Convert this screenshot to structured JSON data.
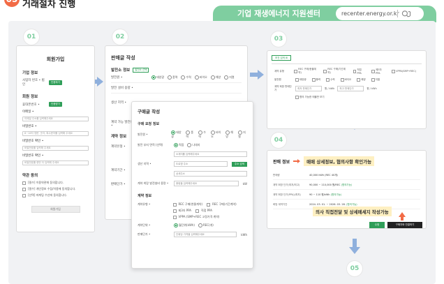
{
  "header": {
    "step_number": "05",
    "title": "거래절차 진행",
    "center_name": "기업 재생에너지 지원센터",
    "url": "recenter.energy.or.kr"
  },
  "steps": [
    "01",
    "02",
    "03",
    "04",
    "05"
  ],
  "card1": {
    "heading": "회원가입",
    "company_section": "기업 정보",
    "company_rows": [
      {
        "label": "사업자 번호 • 법인",
        "button": "인증하기"
      }
    ],
    "member_section": "회원 정보",
    "member_rows": [
      {
        "label": "휴대폰번호 •",
        "button": "인증받기"
      },
      {
        "label": "이메일 •",
        "value": "이메일 주소를 입력해주세요"
      },
      {
        "label": "비밀번호 •",
        "value": "8~16자 영문, 숫자, 특수문자를 입력해 주세요"
      },
      {
        "label": "비밀번호 확인 •",
        "value": "비밀번호를 입력해 주세요"
      },
      {
        "label": "비밀번호 확인 •",
        "value": "비밀번호를 한번 더 입력해 주세요"
      }
    ],
    "terms_section": "약관 동의",
    "terms": [
      "[필수] 이용약관에 동의합니다.",
      "[필수] 개인정보 수집/이용에 동의합니다.",
      "[선택] 마케팅 수신에 동의합니다."
    ],
    "submit": "회원가입"
  },
  "card2": {
    "heading": "판매글 작성",
    "section": "발전소 정보",
    "tag": "발전소 선택",
    "rows": [
      {
        "label": "발전원 •",
        "options": [
          "태양광",
          "풍력",
          "수력",
          "바이오",
          "해양",
          "지열"
        ]
      },
      {
        "label": "발전 설비 용량 •",
        "value": ""
      },
      {
        "label": "생산 지역 •",
        "value": ""
      },
      {
        "label": "계약 가능 발전량 •",
        "value": ""
      }
    ],
    "contract_section": "계약 정보",
    "contract_rows": [
      {
        "label": "계약유형 •"
      },
      {
        "label": "계약기간 •"
      },
      {
        "label": "판매단가 •"
      }
    ]
  },
  "card2b": {
    "heading": "구매글 작성",
    "section": "구매 요청 정보",
    "rows": [
      {
        "label": "발전원 •",
        "options": [
          "태양광",
          "풍력",
          "수력",
          "바이오",
          "해양",
          "지열"
        ]
      },
      {
        "label": "발전 부지 면적 (선택)",
        "options": [
          "직접",
          "시/도/구",
          "나대지"
        ],
        "value": "소재지를 입력해주세요"
      },
      {
        "label": "생산 지역 •",
        "value": "도로명 주소",
        "button": "주소 검색",
        "value2": "상세주소"
      },
      {
        "label": "계약 희망 발전설비 용량 •",
        "value": "용량을 입력해주세요",
        "unit": "kW"
      }
    ],
    "contract_section": "계약 정보",
    "contract_types": [
      "REC 구매(현물계약)",
      "REC 구매(기간계약)",
      "제3자 PPA",
      "직접 PPA",
      "VPPA (SMP+REC 고정가격 계약)"
    ],
    "contract_rows": [
      {
        "label": "계약유형 •"
      },
      {
        "label": "계약단위 •",
        "options": [
          "월단위(kWh)",
          "REC(개)"
        ]
      },
      {
        "label": "판매단가 •",
        "value": "단위당 가격을 입력해주세요",
        "unit": "kWh"
      }
    ]
  },
  "card3": {
    "tab": "조건 검색 ⊞",
    "rows": [
      {
        "label": "계약 유형",
        "options": [
          "REC 구매(현물계약)",
          "REC 구매(기간계약)",
          "직접 PPA",
          "제3자 PPA",
          "VPPA(SMP+REC)"
        ]
      },
      {
        "label": "발전원",
        "options": [
          "태양광",
          "풍력",
          "수력",
          "바이오",
          "해양",
          "지열"
        ]
      },
      {
        "label": "계약 희망 판매단가",
        "min": "최저 판매단가",
        "max": "최고 판매단가",
        "unit": "원 / kWh"
      },
      {
        "label": "",
        "options": [
          "협의 가능한 매물만 보기"
        ]
      }
    ]
  },
  "card4": {
    "title": "판매 정보",
    "highlight": "매매 상세정보, 협의사항 확인가능",
    "rows": [
      {
        "label": "판매량",
        "value": "40,000 kWh (REC 40개)"
      },
      {
        "label": "계약 희망 단가(최저/최고)",
        "value": "90,000 ~ 110,000 원/REC",
        "note": "(협의가능)"
      },
      {
        "label": "계약 희망 단가(PPA)(최저)",
        "value": "90 ~ 110 원/kWh",
        "note": "(협의가능)"
      },
      {
        "label": "희망 계약기간",
        "value": "2024. 03. 01. ~ 2026. 03. 28.",
        "note": "(협의가능)"
      }
    ],
    "callout": "의사 직접전달 및 상세메세지 작성가능",
    "btn_a": "수정",
    "btn_b": "구매자와 연결하기"
  },
  "colors": {
    "accent": "#7fcea0",
    "brand_green": "#2f9e58",
    "orange": "#f26b46",
    "arrow": "#8fb0dd",
    "highlight": "#fef0c2"
  }
}
